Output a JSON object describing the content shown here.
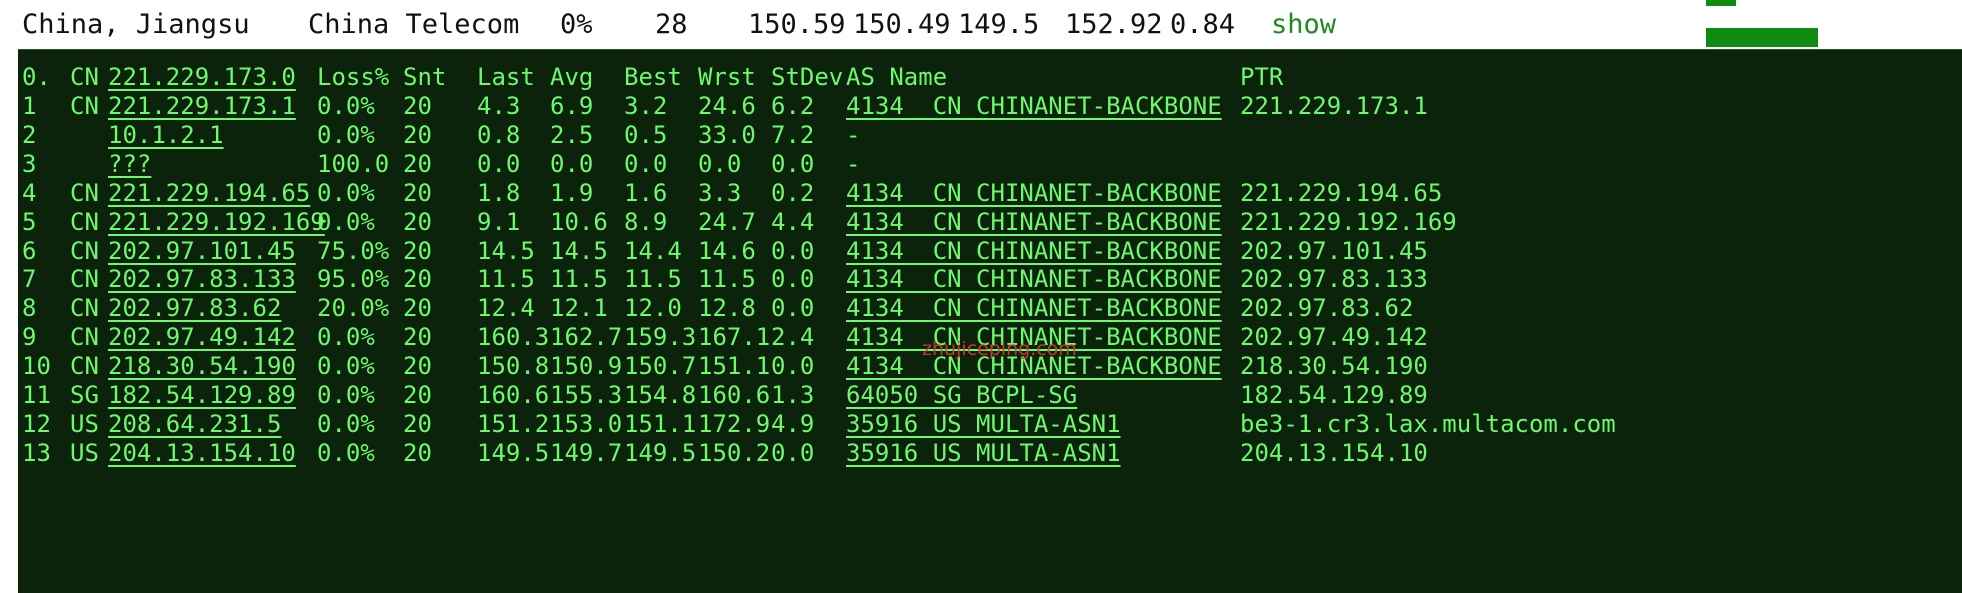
{
  "summary": {
    "location": "China, Jiangsu",
    "isp": "China Telecom",
    "loss": "0%",
    "sent": "28",
    "last": "150.59",
    "avg": "150.49",
    "best": "149.5",
    "worst": "152.92",
    "stdev": "0.84",
    "show_label": "show"
  },
  "headers": {
    "hop": "0.",
    "cc": "CN",
    "host": "221.229.173.0",
    "loss": "Loss%",
    "snt": "Snt",
    "last": "Last",
    "avg": "Avg",
    "best": "Best",
    "wrst": "Wrst",
    "stdev": "StDev",
    "as_name": "AS Name",
    "ptr": "PTR"
  },
  "hops": [
    {
      "hop": "1",
      "cc": "CN",
      "host": "221.229.173.1",
      "loss": "0.0%",
      "snt": "20",
      "last": "4.3",
      "avg": "6.9",
      "best": "3.2",
      "wrst": "24.6",
      "stdev": "6.2",
      "as_name": "4134  CN CHINANET-BACKBONE",
      "ptr": "221.229.173.1"
    },
    {
      "hop": "2",
      "cc": "",
      "host": "10.1.2.1",
      "loss": "0.0%",
      "snt": "20",
      "last": "0.8",
      "avg": "2.5",
      "best": "0.5",
      "wrst": "33.0",
      "stdev": "7.2",
      "as_name": "-",
      "ptr": ""
    },
    {
      "hop": "3",
      "cc": "",
      "host": "???",
      "loss": "100.0",
      "snt": "20",
      "last": "0.0",
      "avg": "0.0",
      "best": "0.0",
      "wrst": "0.0",
      "stdev": "0.0",
      "as_name": "-",
      "ptr": ""
    },
    {
      "hop": "4",
      "cc": "CN",
      "host": "221.229.194.65",
      "loss": "0.0%",
      "snt": "20",
      "last": "1.8",
      "avg": "1.9",
      "best": "1.6",
      "wrst": "3.3",
      "stdev": "0.2",
      "as_name": "4134  CN CHINANET-BACKBONE",
      "ptr": "221.229.194.65"
    },
    {
      "hop": "5",
      "cc": "CN",
      "host": "221.229.192.169",
      "loss": "0.0%",
      "snt": "20",
      "last": "9.1",
      "avg": "10.6",
      "best": "8.9",
      "wrst": "24.7",
      "stdev": "4.4",
      "as_name": "4134  CN CHINANET-BACKBONE",
      "ptr": "221.229.192.169"
    },
    {
      "hop": "6",
      "cc": "CN",
      "host": "202.97.101.45",
      "loss": "75.0%",
      "snt": "20",
      "last": "14.5",
      "avg": "14.5",
      "best": "14.4",
      "wrst": "14.6",
      "stdev": "0.0",
      "as_name": "4134  CN CHINANET-BACKBONE",
      "ptr": "202.97.101.45"
    },
    {
      "hop": "7",
      "cc": "CN",
      "host": "202.97.83.133",
      "loss": "95.0%",
      "snt": "20",
      "last": "11.5",
      "avg": "11.5",
      "best": "11.5",
      "wrst": "11.5",
      "stdev": "0.0",
      "as_name": "4134  CN CHINANET-BACKBONE",
      "ptr": "202.97.83.133"
    },
    {
      "hop": "8",
      "cc": "CN",
      "host": "202.97.83.62",
      "loss": "20.0%",
      "snt": "20",
      "last": "12.4",
      "avg": "12.1",
      "best": "12.0",
      "wrst": "12.8",
      "stdev": "0.0",
      "as_name": "4134  CN CHINANET-BACKBONE",
      "ptr": "202.97.83.62"
    },
    {
      "hop": "9",
      "cc": "CN",
      "host": "202.97.49.142",
      "loss": "0.0%",
      "snt": "20",
      "last": "160.3",
      "avg": "162.7",
      "best": "159.3",
      "wrst": "167.1",
      "stdev": "2.4",
      "as_name": "4134  CN CHINANET-BACKBONE",
      "ptr": "202.97.49.142"
    },
    {
      "hop": "10",
      "cc": "CN",
      "host": "218.30.54.190",
      "loss": "0.0%",
      "snt": "20",
      "last": "150.8",
      "avg": "150.9",
      "best": "150.7",
      "wrst": "151.1",
      "stdev": "0.0",
      "as_name": "4134  CN CHINANET-BACKBONE",
      "ptr": "218.30.54.190"
    },
    {
      "hop": "11",
      "cc": "SG",
      "host": "182.54.129.89",
      "loss": "0.0%",
      "snt": "20",
      "last": "160.6",
      "avg": "155.3",
      "best": "154.8",
      "wrst": "160.6",
      "stdev": "1.3",
      "as_name": "64050 SG BCPL-SG",
      "ptr": "182.54.129.89"
    },
    {
      "hop": "12",
      "cc": "US",
      "host": "208.64.231.5",
      "loss": "0.0%",
      "snt": "20",
      "last": "151.2",
      "avg": "153.0",
      "best": "151.1",
      "wrst": "172.9",
      "stdev": "4.9",
      "as_name": "35916 US MULTA-ASN1",
      "ptr": "be3-1.cr3.lax.multacom.com"
    },
    {
      "hop": "13",
      "cc": "US",
      "host": "204.13.154.10",
      "loss": "0.0%",
      "snt": "20",
      "last": "149.5",
      "avg": "149.7",
      "best": "149.5",
      "wrst": "150.2",
      "stdev": "0.0",
      "as_name": "35916 US MULTA-ASN1",
      "ptr": "204.13.154.10"
    }
  ],
  "watermark": "zhujiceping.com",
  "colors": {
    "terminal_bg": "#0b220b",
    "terminal_fg": "#6cfa6c",
    "graph_green": "#0f8c0f",
    "watermark": "#e0343a"
  }
}
